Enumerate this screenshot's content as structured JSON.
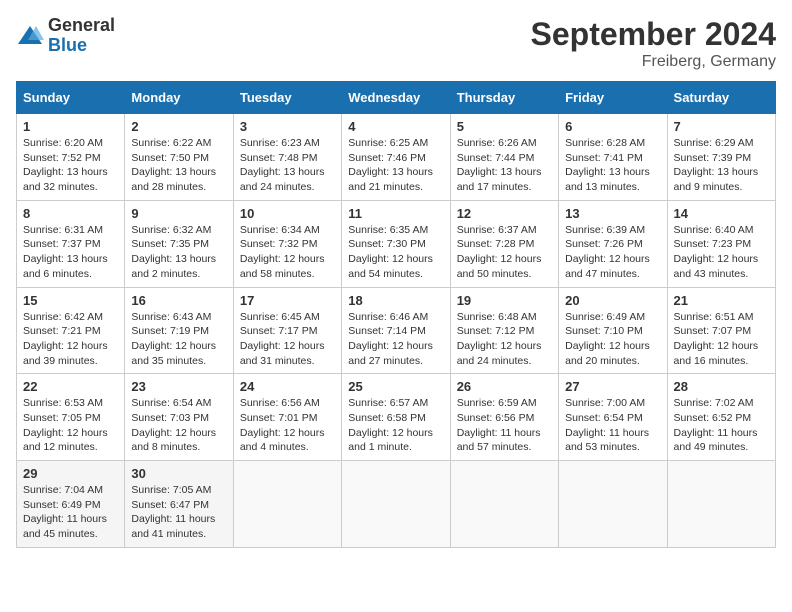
{
  "header": {
    "logo_general": "General",
    "logo_blue": "Blue",
    "month_year": "September 2024",
    "location": "Freiberg, Germany"
  },
  "calendar": {
    "headers": [
      "Sunday",
      "Monday",
      "Tuesday",
      "Wednesday",
      "Thursday",
      "Friday",
      "Saturday"
    ],
    "weeks": [
      [
        {
          "day": "1",
          "info": "Sunrise: 6:20 AM\nSunset: 7:52 PM\nDaylight: 13 hours\nand 32 minutes."
        },
        {
          "day": "2",
          "info": "Sunrise: 6:22 AM\nSunset: 7:50 PM\nDaylight: 13 hours\nand 28 minutes."
        },
        {
          "day": "3",
          "info": "Sunrise: 6:23 AM\nSunset: 7:48 PM\nDaylight: 13 hours\nand 24 minutes."
        },
        {
          "day": "4",
          "info": "Sunrise: 6:25 AM\nSunset: 7:46 PM\nDaylight: 13 hours\nand 21 minutes."
        },
        {
          "day": "5",
          "info": "Sunrise: 6:26 AM\nSunset: 7:44 PM\nDaylight: 13 hours\nand 17 minutes."
        },
        {
          "day": "6",
          "info": "Sunrise: 6:28 AM\nSunset: 7:41 PM\nDaylight: 13 hours\nand 13 minutes."
        },
        {
          "day": "7",
          "info": "Sunrise: 6:29 AM\nSunset: 7:39 PM\nDaylight: 13 hours\nand 9 minutes."
        }
      ],
      [
        {
          "day": "8",
          "info": "Sunrise: 6:31 AM\nSunset: 7:37 PM\nDaylight: 13 hours\nand 6 minutes."
        },
        {
          "day": "9",
          "info": "Sunrise: 6:32 AM\nSunset: 7:35 PM\nDaylight: 13 hours\nand 2 minutes."
        },
        {
          "day": "10",
          "info": "Sunrise: 6:34 AM\nSunset: 7:32 PM\nDaylight: 12 hours\nand 58 minutes."
        },
        {
          "day": "11",
          "info": "Sunrise: 6:35 AM\nSunset: 7:30 PM\nDaylight: 12 hours\nand 54 minutes."
        },
        {
          "day": "12",
          "info": "Sunrise: 6:37 AM\nSunset: 7:28 PM\nDaylight: 12 hours\nand 50 minutes."
        },
        {
          "day": "13",
          "info": "Sunrise: 6:39 AM\nSunset: 7:26 PM\nDaylight: 12 hours\nand 47 minutes."
        },
        {
          "day": "14",
          "info": "Sunrise: 6:40 AM\nSunset: 7:23 PM\nDaylight: 12 hours\nand 43 minutes."
        }
      ],
      [
        {
          "day": "15",
          "info": "Sunrise: 6:42 AM\nSunset: 7:21 PM\nDaylight: 12 hours\nand 39 minutes."
        },
        {
          "day": "16",
          "info": "Sunrise: 6:43 AM\nSunset: 7:19 PM\nDaylight: 12 hours\nand 35 minutes."
        },
        {
          "day": "17",
          "info": "Sunrise: 6:45 AM\nSunset: 7:17 PM\nDaylight: 12 hours\nand 31 minutes."
        },
        {
          "day": "18",
          "info": "Sunrise: 6:46 AM\nSunset: 7:14 PM\nDaylight: 12 hours\nand 27 minutes."
        },
        {
          "day": "19",
          "info": "Sunrise: 6:48 AM\nSunset: 7:12 PM\nDaylight: 12 hours\nand 24 minutes."
        },
        {
          "day": "20",
          "info": "Sunrise: 6:49 AM\nSunset: 7:10 PM\nDaylight: 12 hours\nand 20 minutes."
        },
        {
          "day": "21",
          "info": "Sunrise: 6:51 AM\nSunset: 7:07 PM\nDaylight: 12 hours\nand 16 minutes."
        }
      ],
      [
        {
          "day": "22",
          "info": "Sunrise: 6:53 AM\nSunset: 7:05 PM\nDaylight: 12 hours\nand 12 minutes."
        },
        {
          "day": "23",
          "info": "Sunrise: 6:54 AM\nSunset: 7:03 PM\nDaylight: 12 hours\nand 8 minutes."
        },
        {
          "day": "24",
          "info": "Sunrise: 6:56 AM\nSunset: 7:01 PM\nDaylight: 12 hours\nand 4 minutes."
        },
        {
          "day": "25",
          "info": "Sunrise: 6:57 AM\nSunset: 6:58 PM\nDaylight: 12 hours\nand 1 minute."
        },
        {
          "day": "26",
          "info": "Sunrise: 6:59 AM\nSunset: 6:56 PM\nDaylight: 11 hours\nand 57 minutes."
        },
        {
          "day": "27",
          "info": "Sunrise: 7:00 AM\nSunset: 6:54 PM\nDaylight: 11 hours\nand 53 minutes."
        },
        {
          "day": "28",
          "info": "Sunrise: 7:02 AM\nSunset: 6:52 PM\nDaylight: 11 hours\nand 49 minutes."
        }
      ],
      [
        {
          "day": "29",
          "info": "Sunrise: 7:04 AM\nSunset: 6:49 PM\nDaylight: 11 hours\nand 45 minutes."
        },
        {
          "day": "30",
          "info": "Sunrise: 7:05 AM\nSunset: 6:47 PM\nDaylight: 11 hours\nand 41 minutes."
        },
        {
          "day": "",
          "info": ""
        },
        {
          "day": "",
          "info": ""
        },
        {
          "day": "",
          "info": ""
        },
        {
          "day": "",
          "info": ""
        },
        {
          "day": "",
          "info": ""
        }
      ]
    ]
  }
}
